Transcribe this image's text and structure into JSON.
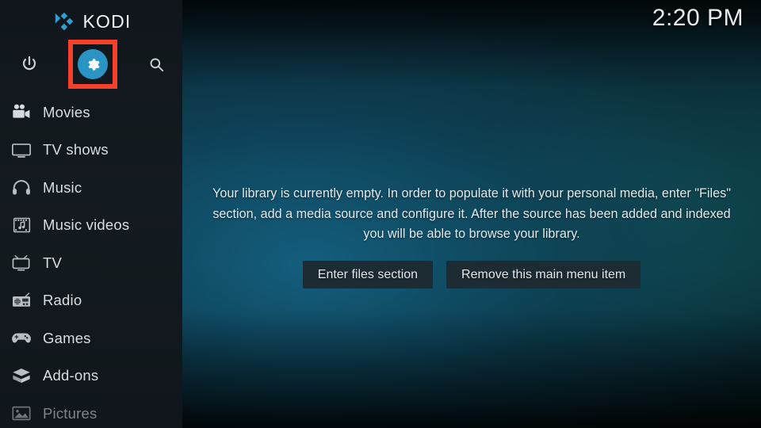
{
  "app": {
    "brand": "KODI",
    "logo_icon": "kodi-logo-icon"
  },
  "colors": {
    "accent_blue": "#2a95c4",
    "annotation_red": "#f5402c",
    "sidebar_bg": "#141b20",
    "button_bg": "#1d2b33",
    "text_primary": "#d9dde0",
    "text_dim": "#7e858a"
  },
  "header": {
    "clock": "2:20 PM"
  },
  "sidebar": {
    "top_actions": [
      {
        "name": "power-icon",
        "label": "Power"
      },
      {
        "name": "settings-gear-icon",
        "label": "Settings",
        "highlighted": true
      },
      {
        "name": "search-icon",
        "label": "Search"
      }
    ],
    "items": [
      {
        "label": "Movies",
        "icon": "movie-camera-icon",
        "dim": false
      },
      {
        "label": "TV shows",
        "icon": "television-icon",
        "dim": false
      },
      {
        "label": "Music",
        "icon": "headphones-icon",
        "dim": false
      },
      {
        "label": "Music videos",
        "icon": "film-music-icon",
        "dim": false
      },
      {
        "label": "TV",
        "icon": "retro-tv-icon",
        "dim": false
      },
      {
        "label": "Radio",
        "icon": "radio-icon",
        "dim": false
      },
      {
        "label": "Games",
        "icon": "gamepad-icon",
        "dim": false
      },
      {
        "label": "Add-ons",
        "icon": "addon-box-icon",
        "dim": false
      },
      {
        "label": "Pictures",
        "icon": "pictures-icon",
        "dim": true
      }
    ]
  },
  "main": {
    "empty_message": "Your library is currently empty. In order to populate it with your personal media, enter \"Files\" section, add a media source and configure it. After the source has been added and indexed you will be able to browse your library.",
    "buttons": [
      {
        "label": "Enter files section"
      },
      {
        "label": "Remove this main menu item"
      }
    ]
  }
}
